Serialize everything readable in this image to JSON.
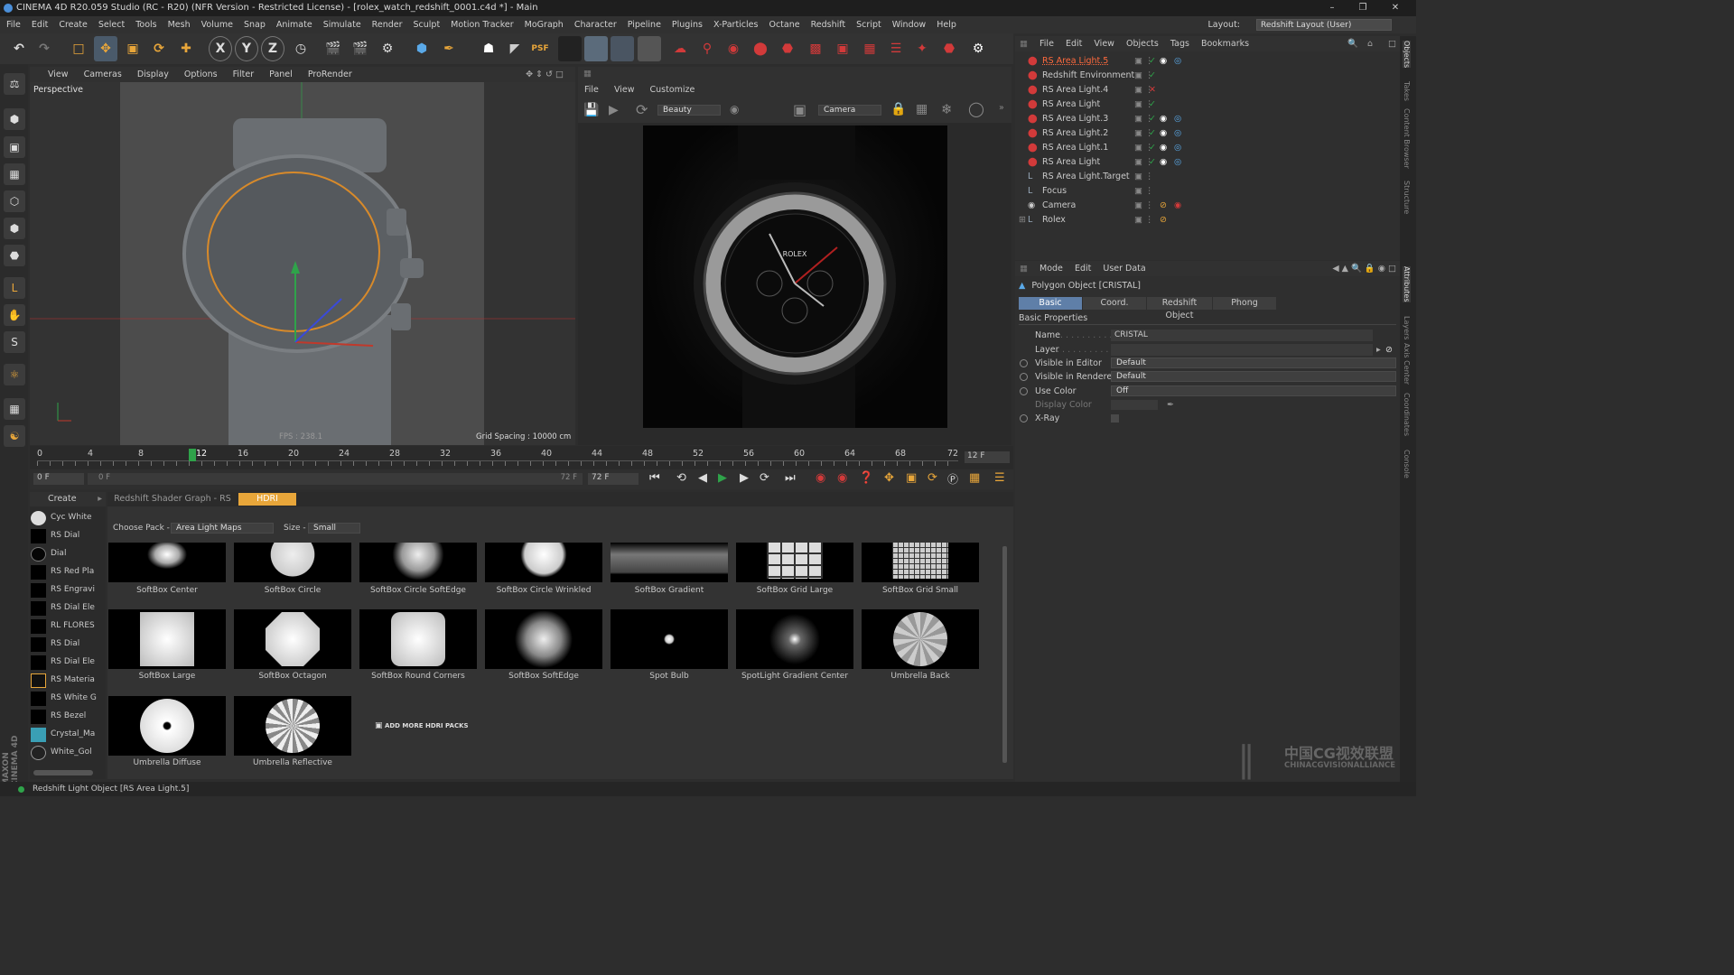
{
  "window": {
    "title": "CINEMA 4D R20.059 Studio (RC - R20) (NFR Version - Restricted License) - [rolex_watch_redshift_0001.c4d *] - Main",
    "layout_label": "Layout:",
    "layout_value": "Redshift Layout (User)"
  },
  "menus": [
    "File",
    "Edit",
    "Create",
    "Select",
    "Tools",
    "Mesh",
    "Volume",
    "Snap",
    "Animate",
    "Simulate",
    "Render",
    "Sculpt",
    "Motion Tracker",
    "MoGraph",
    "Character",
    "Pipeline",
    "Plugins",
    "X-Particles",
    "Octane",
    "Redshift",
    "Script",
    "Window",
    "Help"
  ],
  "viewport": {
    "menu": [
      "View",
      "Cameras",
      "Display",
      "Options",
      "Filter",
      "Panel",
      "ProRender"
    ],
    "label": "Perspective",
    "fps": "FPS : 238.1",
    "grid": "Grid Spacing : 10000 cm"
  },
  "renderview": {
    "menu": [
      "File",
      "View",
      "Customize"
    ],
    "aov": "Beauty",
    "camera": "Camera"
  },
  "timeline": {
    "ticks": [
      "0",
      "4",
      "8",
      "12",
      "16",
      "20",
      "24",
      "28",
      "32",
      "36",
      "40",
      "44",
      "48",
      "52",
      "56",
      "60",
      "64",
      "68",
      "72"
    ],
    "end_field": "12 F",
    "start": "0 F",
    "range_start": "0 F",
    "range_end": "72 F",
    "max": "72 F"
  },
  "object_manager": {
    "menu": [
      "File",
      "Edit",
      "View",
      "Objects",
      "Tags",
      "Bookmarks"
    ],
    "objects": [
      {
        "name": "RS Area Light.5",
        "selected": true
      },
      {
        "name": "Redshift Environment"
      },
      {
        "name": "RS Area Light.4"
      },
      {
        "name": "RS Area Light"
      },
      {
        "name": "RS Area Light.3"
      },
      {
        "name": "RS Area Light.2"
      },
      {
        "name": "RS Area Light.1"
      },
      {
        "name": "RS Area Light"
      },
      {
        "name": "RS Area Light.Target"
      },
      {
        "name": "Focus"
      },
      {
        "name": "Camera"
      },
      {
        "name": "Rolex"
      }
    ]
  },
  "attributes": {
    "menu": [
      "Mode",
      "Edit",
      "User Data"
    ],
    "object_title": "Polygon Object [CRISTAL]",
    "tabs": [
      "Basic",
      "Coord.",
      "Redshift Object",
      "Phong"
    ],
    "section": "Basic Properties",
    "fields": {
      "name_label": "Name",
      "name_value": "CRISTAL",
      "layer_label": "Layer",
      "vis_editor_label": "Visible in Editor",
      "vis_editor_value": "Default",
      "vis_render_label": "Visible in Renderer",
      "vis_render_value": "Default",
      "use_color_label": "Use Color",
      "use_color_value": "Off",
      "display_color_label": "Display Color",
      "xray_label": "X-Ray"
    }
  },
  "materials": {
    "create_label": "Create",
    "items": [
      "Cyc White",
      "RS Dial",
      "Dial",
      "RS Red Pla",
      "RS Engravi",
      "RS Dial Ele",
      "RL FLORES",
      "RS Dial",
      "RS Dial Ele",
      "RS Materia",
      "RS White G",
      "RS Bezel",
      "Crystal_Ma",
      "White_Gol"
    ]
  },
  "hdri": {
    "tabs": [
      "Redshift Shader Graph - RS Dial",
      "HDRI Browser"
    ],
    "choose_pack_label": "Choose Pack -",
    "pack": "Area Light Maps",
    "size_label": "Size -",
    "size": "Small",
    "items": [
      "SoftBox Center",
      "SoftBox Circle",
      "SoftBox Circle SoftEdge",
      "SoftBox Circle Wrinkled",
      "SoftBox Gradient",
      "SoftBox Grid Large",
      "SoftBox Grid Small",
      "SoftBox Large",
      "SoftBox Octagon",
      "SoftBox Round Corners",
      "SoftBox SoftEdge",
      "Spot Bulb",
      "SpotLight Gradient Center",
      "Umbrella Back",
      "Umbrella Diffuse",
      "Umbrella Reflective"
    ],
    "add_more": "ADD MORE HDRI PACKS"
  },
  "status": {
    "text": "Redshift Light Object [RS Area Light.5]"
  },
  "watermark": {
    "cn": "中国CG视效联盟",
    "en": "CHINACGVISIONALLIANCE"
  },
  "right_tabs": [
    "Objects",
    "Takes",
    "Content Browser",
    "Structure",
    "Attributes",
    "Layers",
    "Axis Center",
    "Coordinates",
    "Console"
  ],
  "colors": {
    "accent": "#e8a63a",
    "selected_text": "#ff6a3d",
    "red_tool": "#d23a3a"
  }
}
